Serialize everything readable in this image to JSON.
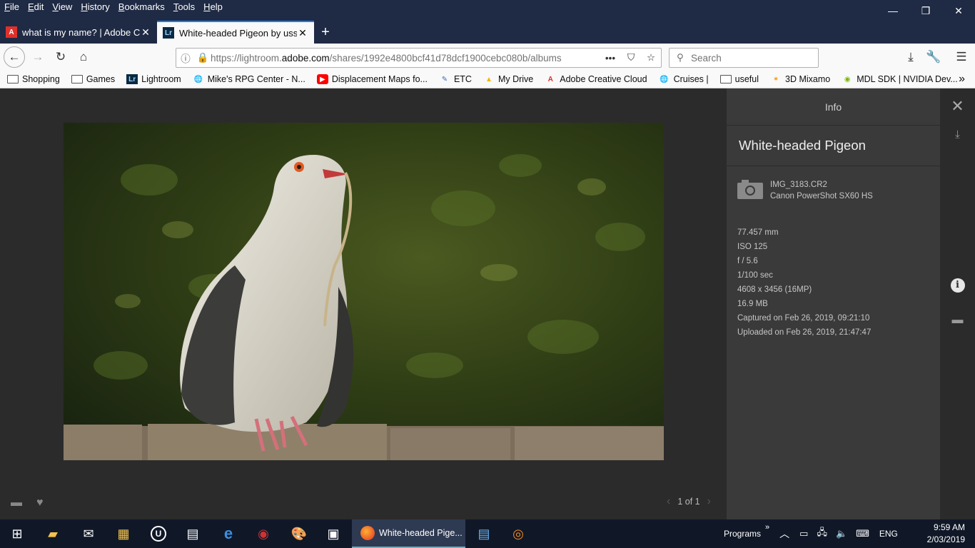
{
  "menu": [
    "File",
    "Edit",
    "View",
    "History",
    "Bookmarks",
    "Tools",
    "Help"
  ],
  "window_controls": {
    "minimize": "—",
    "restore": "❐",
    "close": "✕"
  },
  "tabs": [
    {
      "title": "what is my name? | Adobe Con",
      "favicon": "adobe-icon",
      "favicon_color": "#e0302a",
      "active": false
    },
    {
      "title": "White-headed Pigeon by ussno",
      "favicon": "lightroom-icon",
      "favicon_color": "#0a2a42",
      "active": true
    }
  ],
  "navbar": {
    "url_prefix": "https://lightroom.",
    "url_domain": "adobe.com",
    "url_rest": "/shares/1992e4800bcf41d78dcf1900cebc080b/albums",
    "page_actions": "•••",
    "search_placeholder": "Search"
  },
  "bookmarks": [
    {
      "label": "Shopping",
      "icon": "folder-icon"
    },
    {
      "label": "Games",
      "icon": "folder-icon"
    },
    {
      "label": "Lightroom",
      "icon": "lightroom-icon"
    },
    {
      "label": "Mike's RPG Center - N...",
      "icon": "globe-icon"
    },
    {
      "label": "Displacement Maps fo...",
      "icon": "youtube-icon"
    },
    {
      "label": "ETC",
      "icon": "etc-icon"
    },
    {
      "label": "My Drive",
      "icon": "drive-icon"
    },
    {
      "label": "Adobe Creative Cloud",
      "icon": "adobe-icon"
    },
    {
      "label": "Cruises |",
      "icon": "globe-icon"
    },
    {
      "label": "useful",
      "icon": "folder-icon"
    },
    {
      "label": "3D Mixamo",
      "icon": "mixamo-icon"
    },
    {
      "label": "MDL SDK | NVIDIA Dev...",
      "icon": "nvidia-icon"
    }
  ],
  "viewer": {
    "pager_text": "1 of 1",
    "photo_subject": "white-headed pigeon on fence"
  },
  "info": {
    "header": "Info",
    "title": "White-headed Pigeon",
    "filename": "IMG_3183.CR2",
    "camera": "Canon PowerShot SX60 HS",
    "focal_length": "77.457 mm",
    "iso": "ISO 125",
    "aperture": "f / 5.6",
    "shutter": "1/100 sec",
    "dimensions": "4608 x 3456 (16MP)",
    "size": "16.9 MB",
    "captured": "Captured on Feb 26, 2019, 09:21:10",
    "uploaded": "Uploaded on Feb 26, 2019, 21:47:47"
  },
  "taskbar": {
    "active_app": "White-headed Pige...",
    "programs_label": "Programs",
    "language": "ENG",
    "time": "9:59 AM",
    "date": "2/03/2019"
  },
  "colors": {
    "firefox_chrome": "#1f2a44",
    "accent": "#0a84ff",
    "panel": "#3a3a3a"
  }
}
